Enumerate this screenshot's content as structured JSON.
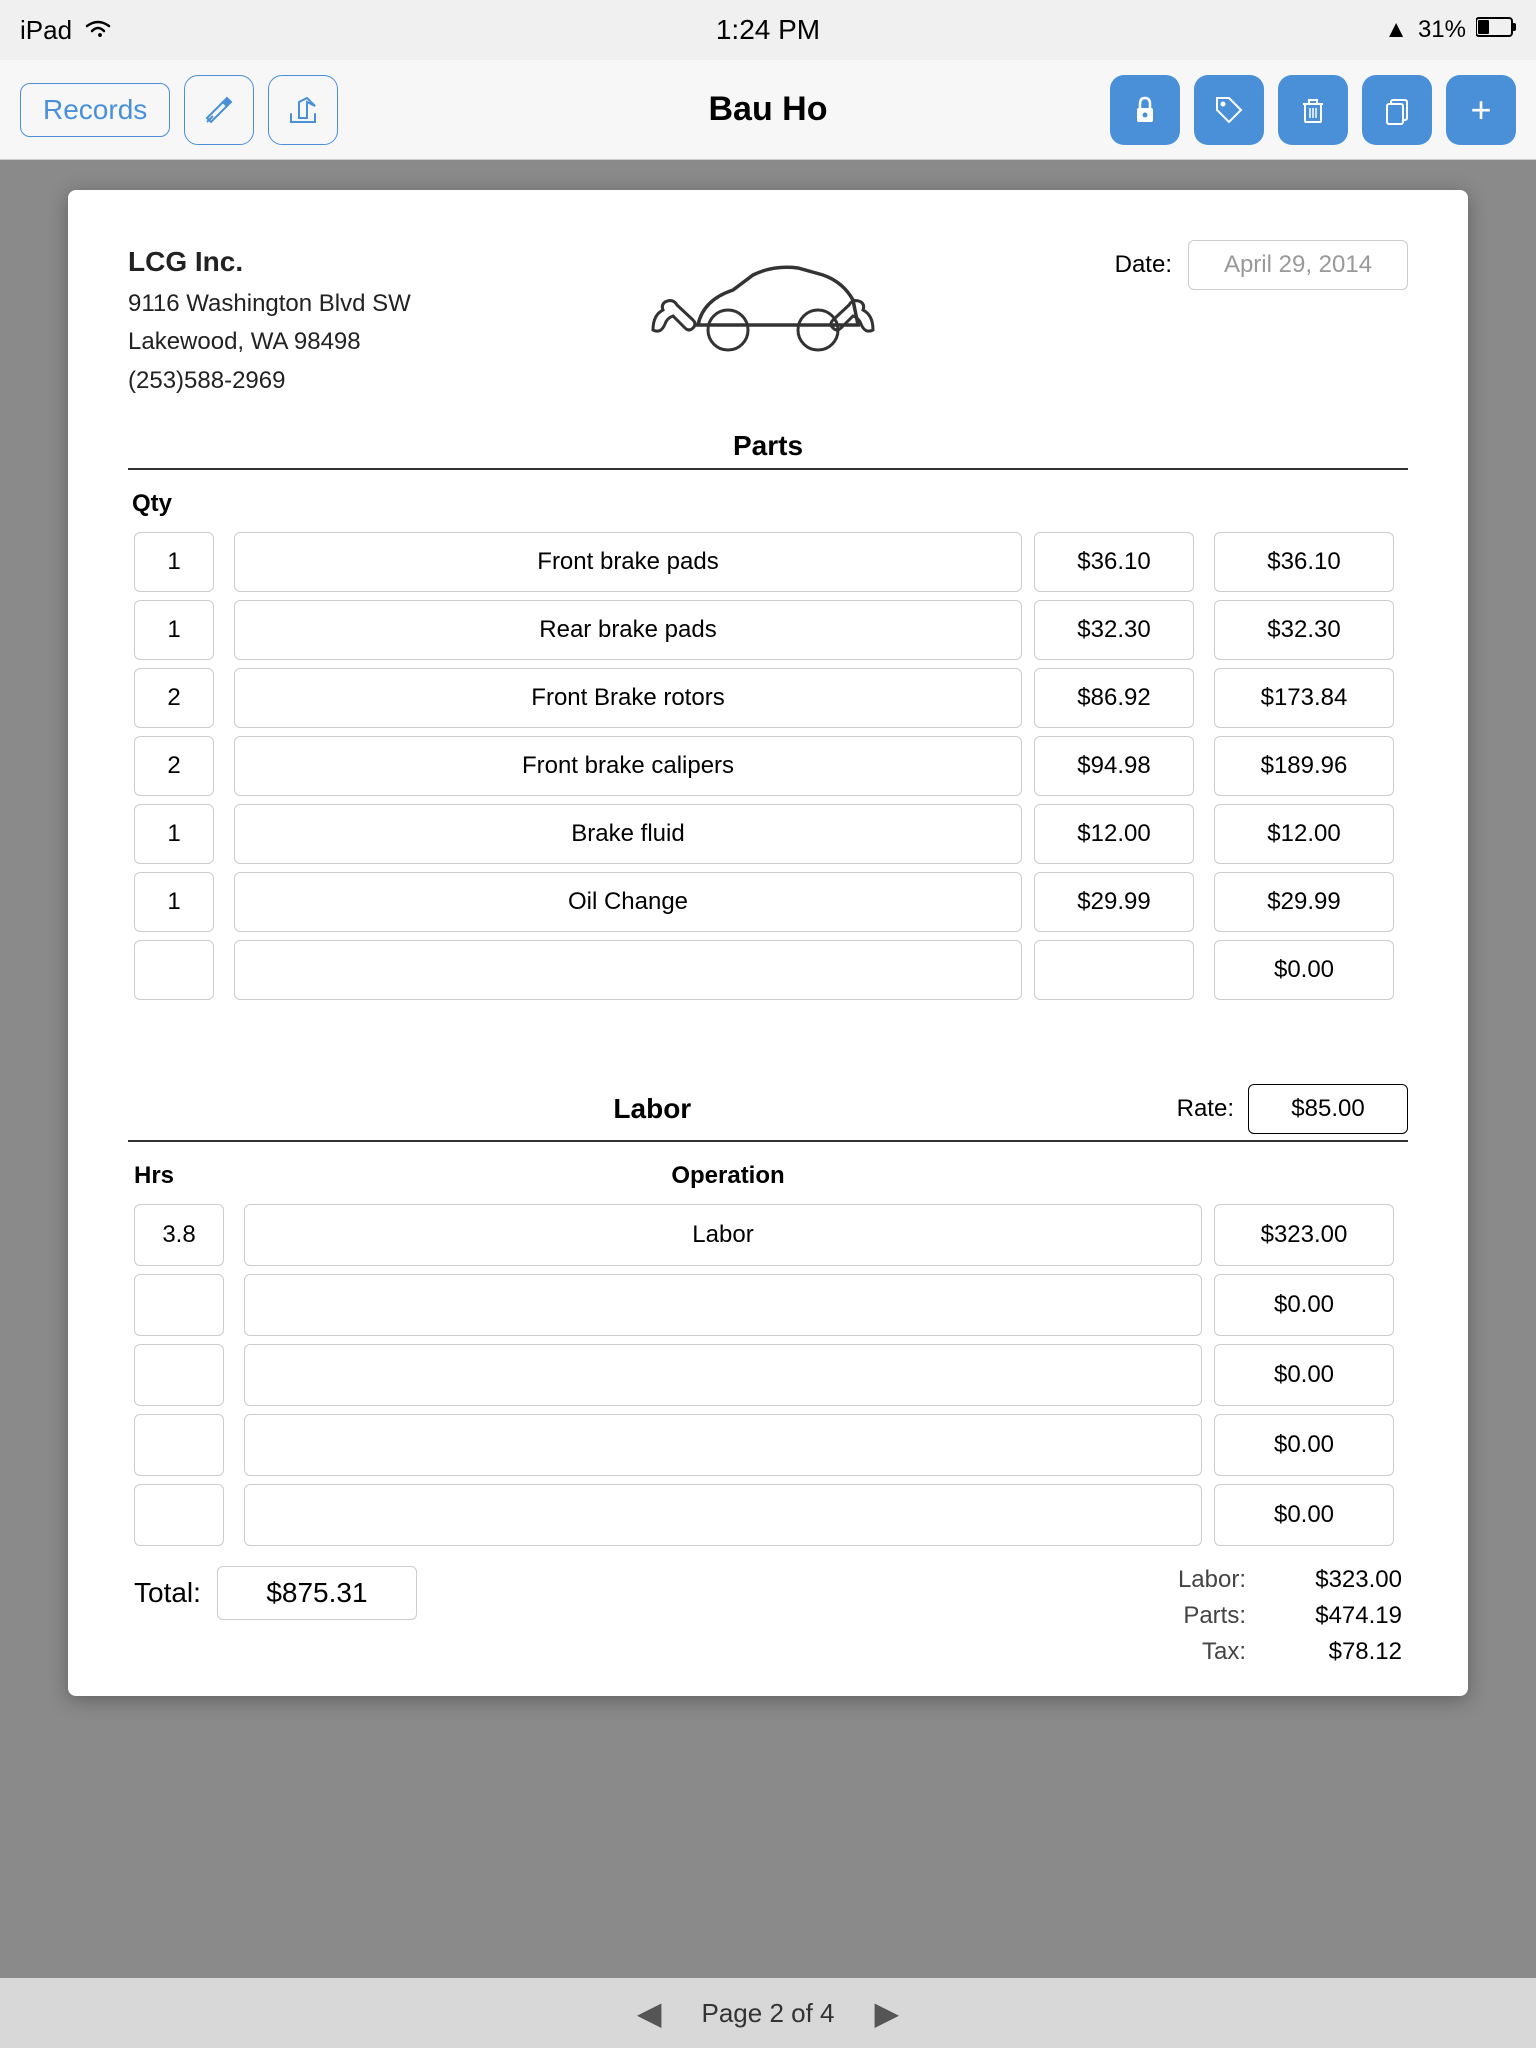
{
  "statusBar": {
    "carrier": "iPad",
    "wifi": "wifi",
    "time": "1:24 PM",
    "signal": "▲",
    "battery": "31%"
  },
  "toolbar": {
    "recordsLabel": "Records",
    "title": "Bau Ho",
    "buttons": {
      "edit": "✏️",
      "share": "↗",
      "lock": "🔒",
      "tag": "🏷",
      "trash": "🗑",
      "copy": "📋",
      "add": "+"
    }
  },
  "document": {
    "company": {
      "name": "LCG Inc.",
      "address1": "9116 Washington Blvd SW",
      "address2": "Lakewood, WA  98498",
      "phone": "(253)588-2969"
    },
    "dateLabel": "Date:",
    "dateValue": "April 29, 2014",
    "partsSection": {
      "title": "Parts",
      "qtyHeader": "Qty",
      "items": [
        {
          "qty": "1",
          "desc": "Front brake pads",
          "price": "$36.10",
          "total": "$36.10"
        },
        {
          "qty": "1",
          "desc": "Rear brake pads",
          "price": "$32.30",
          "total": "$32.30"
        },
        {
          "qty": "2",
          "desc": "Front Brake rotors",
          "price": "$86.92",
          "total": "$173.84"
        },
        {
          "qty": "2",
          "desc": "Front brake calipers",
          "price": "$94.98",
          "total": "$189.96"
        },
        {
          "qty": "1",
          "desc": "Brake fluid",
          "price": "$12.00",
          "total": "$12.00"
        },
        {
          "qty": "1",
          "desc": "Oil Change",
          "price": "$29.99",
          "total": "$29.99"
        },
        {
          "qty": "",
          "desc": "",
          "price": "",
          "total": "$0.00"
        }
      ]
    },
    "laborSection": {
      "title": "Labor",
      "rateLabel": "Rate:",
      "rateValue": "$85.00",
      "hrsHeader": "Hrs",
      "operationHeader": "Operation",
      "items": [
        {
          "hrs": "3.8",
          "op": "Labor",
          "total": "$323.00"
        },
        {
          "hrs": "",
          "op": "",
          "total": "$0.00"
        },
        {
          "hrs": "",
          "op": "",
          "total": "$0.00"
        },
        {
          "hrs": "",
          "op": "",
          "total": "$0.00"
        },
        {
          "hrs": "",
          "op": "",
          "total": "$0.00"
        }
      ]
    },
    "summary": {
      "totalLabel": "Total:",
      "totalValue": "$875.31",
      "laborLabel": "Labor:",
      "laborValue": "$323.00",
      "partsLabel": "Parts:",
      "partsValue": "$474.19",
      "taxLabel": "Tax:",
      "taxValue": "$78.12"
    }
  },
  "pagination": {
    "label": "Page 2 of 4",
    "prevArrow": "◀",
    "nextArrow": "▶"
  }
}
